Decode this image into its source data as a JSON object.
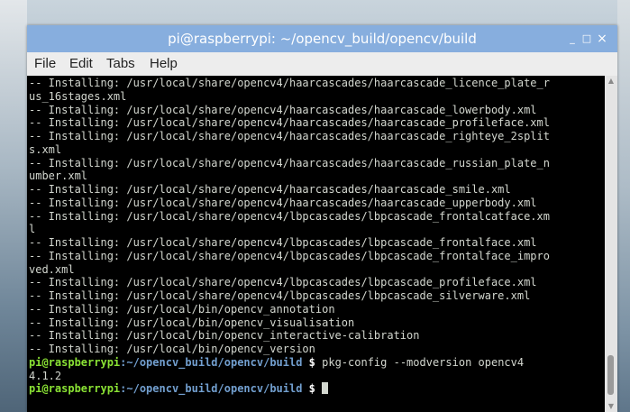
{
  "window": {
    "title": "pi@raspberrypi: ~/opencv_build/opencv/build",
    "minimize_symbol": "_",
    "maximize_symbol": "□",
    "close_symbol": "×"
  },
  "menu": {
    "items": [
      "File",
      "Edit",
      "Tabs",
      "Help"
    ]
  },
  "terminal": {
    "output_lines": [
      "-- Installing: /usr/local/share/opencv4/haarcascades/haarcascade_licence_plate_r",
      "us_16stages.xml",
      "-- Installing: /usr/local/share/opencv4/haarcascades/haarcascade_lowerbody.xml",
      "-- Installing: /usr/local/share/opencv4/haarcascades/haarcascade_profileface.xml",
      "-- Installing: /usr/local/share/opencv4/haarcascades/haarcascade_righteye_2split",
      "s.xml",
      "-- Installing: /usr/local/share/opencv4/haarcascades/haarcascade_russian_plate_n",
      "umber.xml",
      "-- Installing: /usr/local/share/opencv4/haarcascades/haarcascade_smile.xml",
      "-- Installing: /usr/local/share/opencv4/haarcascades/haarcascade_upperbody.xml",
      "-- Installing: /usr/local/share/opencv4/lbpcascades/lbpcascade_frontalcatface.xm",
      "l",
      "-- Installing: /usr/local/share/opencv4/lbpcascades/lbpcascade_frontalface.xml",
      "-- Installing: /usr/local/share/opencv4/lbpcascades/lbpcascade_frontalface_impro",
      "ved.xml",
      "-- Installing: /usr/local/share/opencv4/lbpcascades/lbpcascade_profileface.xml",
      "-- Installing: /usr/local/share/opencv4/lbpcascades/lbpcascade_silverware.xml",
      "-- Installing: /usr/local/bin/opencv_annotation",
      "-- Installing: /usr/local/bin/opencv_visualisation",
      "-- Installing: /usr/local/bin/opencv_interactive-calibration",
      "-- Installing: /usr/local/bin/opencv_version"
    ],
    "command_prompt": {
      "user": "pi@raspberrypi",
      "path": ":~/opencv_build/opencv/build",
      "sign": " $",
      "command": " pkg-config --modversion opencv4"
    },
    "command_output": "4.1.2",
    "current_prompt": {
      "user": "pi@raspberrypi",
      "path": ":~/opencv_build/opencv/build",
      "sign": " $",
      "input": " "
    }
  },
  "colors": {
    "titlebar": "#87aede",
    "terminal_bg": "#000000",
    "terminal_fg": "#d3d7cf",
    "prompt_user": "#8ae234",
    "prompt_path": "#729fcf"
  }
}
